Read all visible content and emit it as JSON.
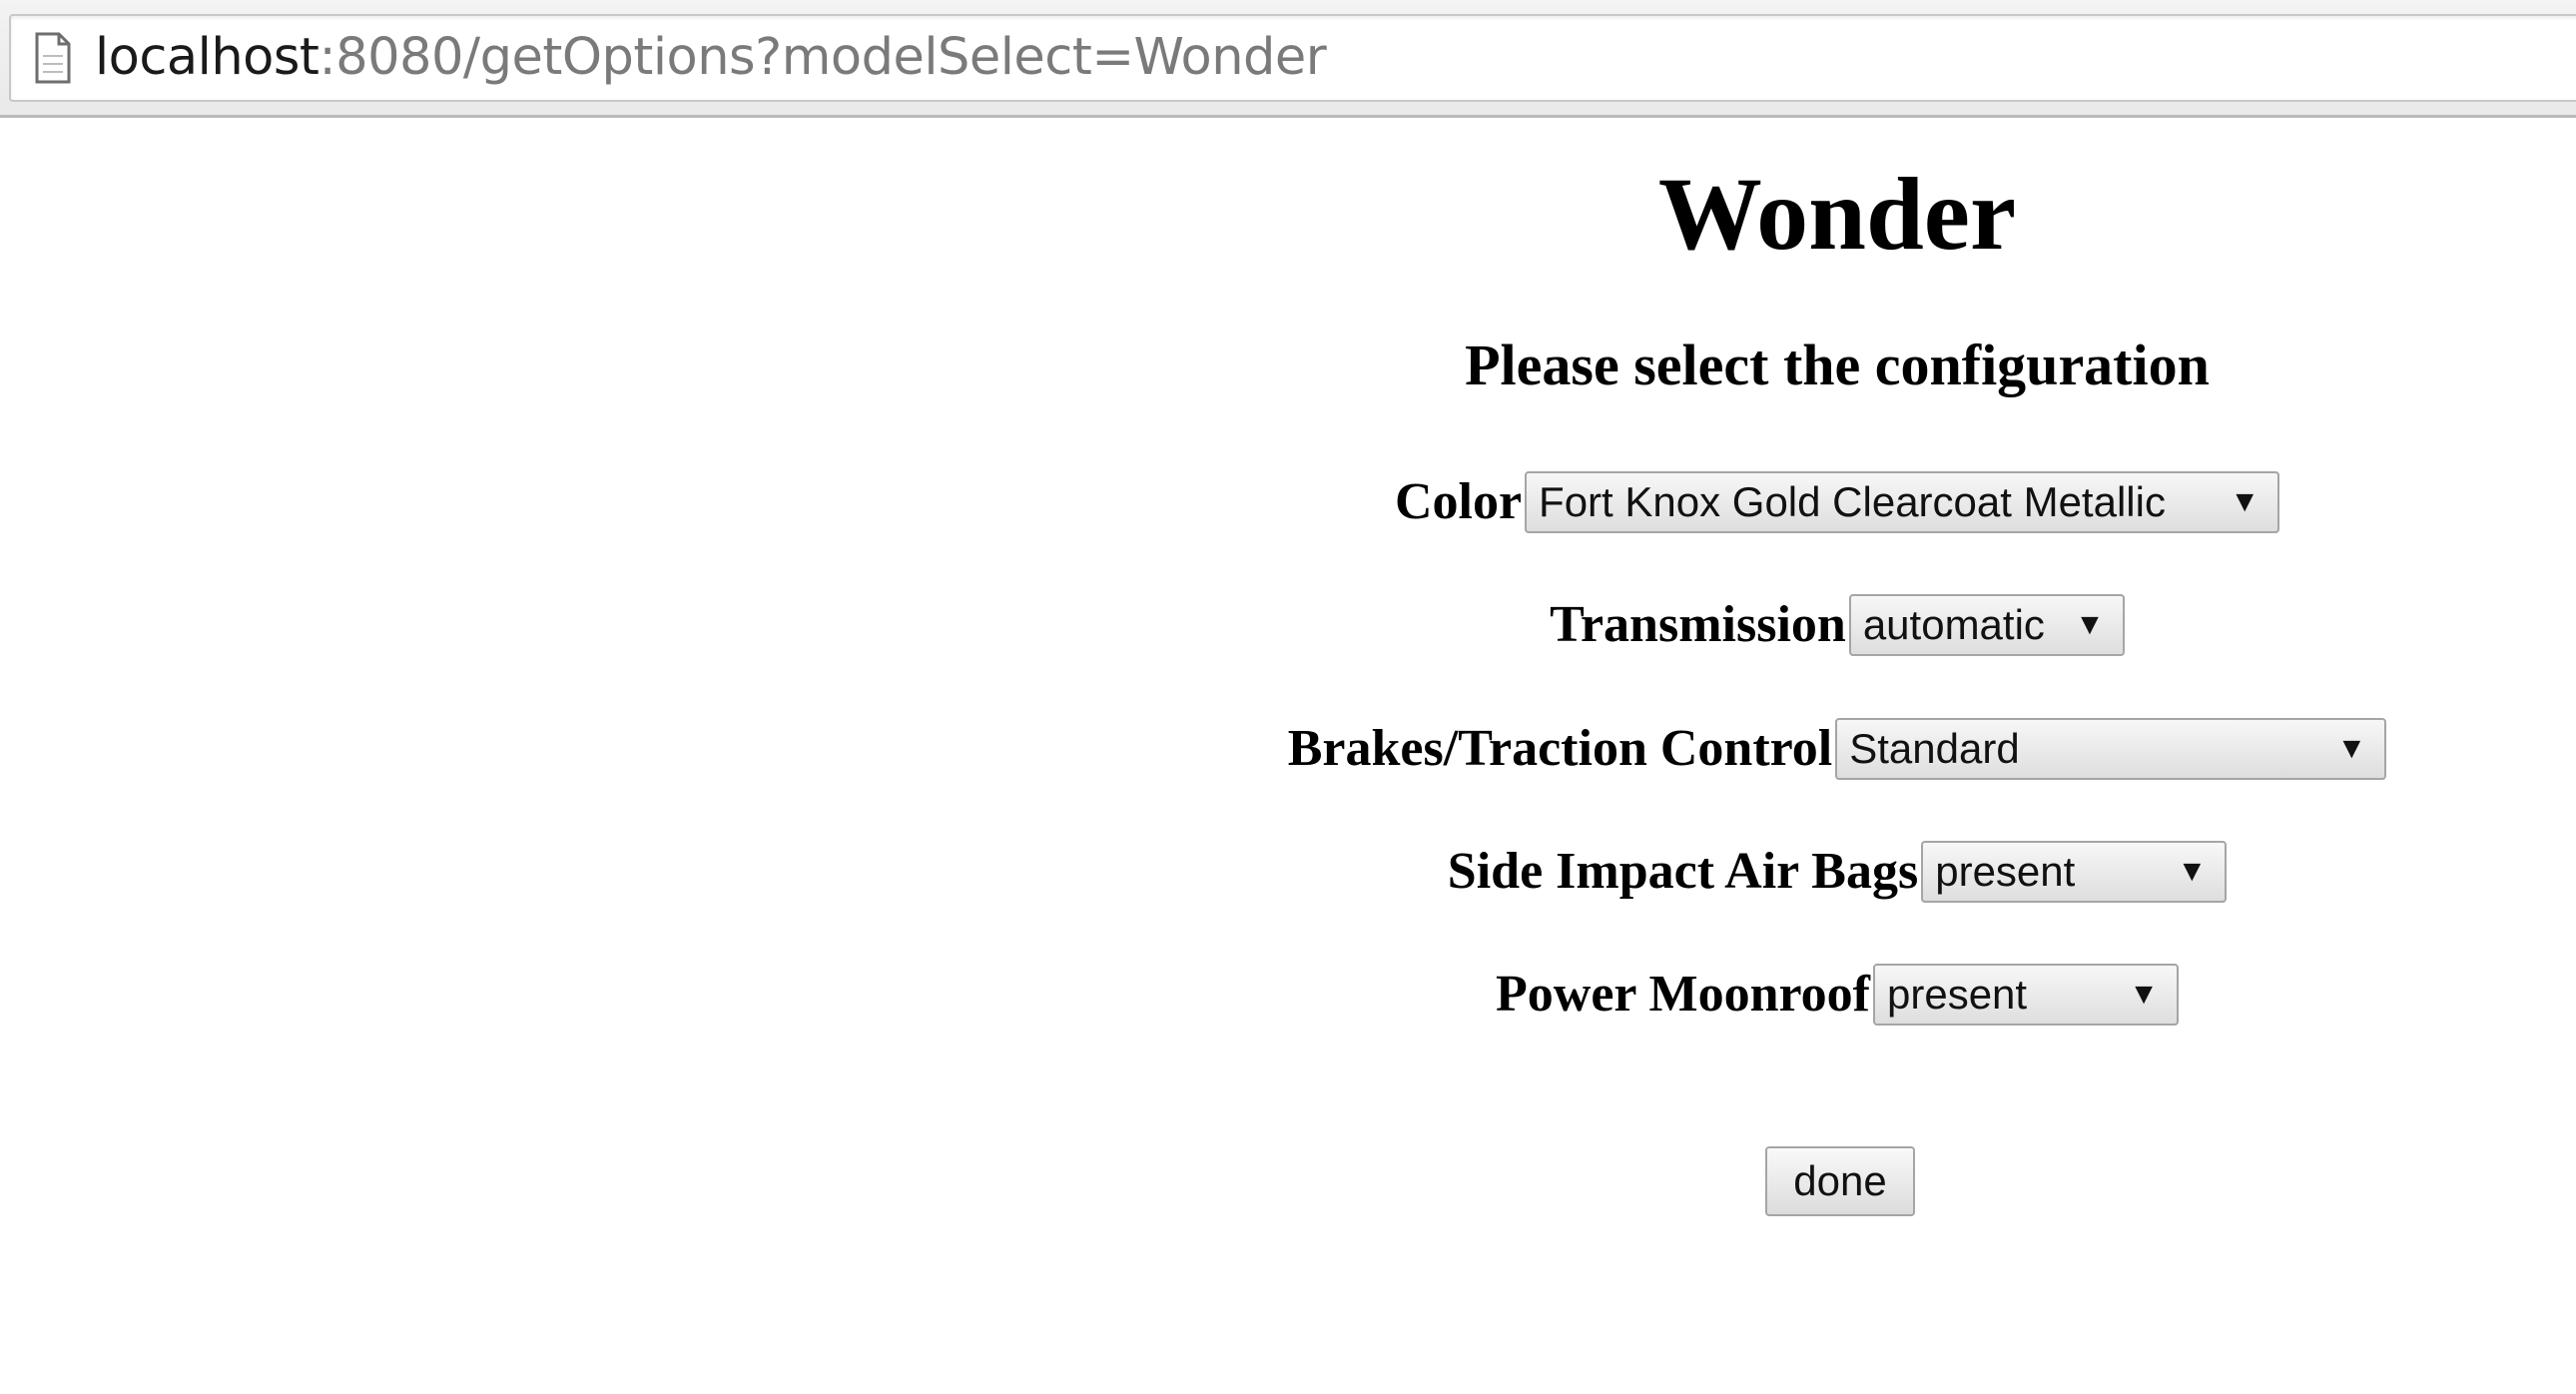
{
  "browser": {
    "url_host": "localhost",
    "url_rest": ":8080/getOptions?modelSelect=Wonder"
  },
  "page": {
    "title": "Wonder",
    "subtitle": "Please select the configuration"
  },
  "options": [
    {
      "label": "Color",
      "selected": "Fort Knox Gold Clearcoat Metallic"
    },
    {
      "label": "Transmission",
      "selected": "automatic"
    },
    {
      "label": "Brakes/Traction Control",
      "selected": "Standard"
    },
    {
      "label": "Side Impact Air Bags",
      "selected": "present"
    },
    {
      "label": "Power Moonroof",
      "selected": "present"
    }
  ],
  "done_label": "done",
  "icons": {
    "page": "page-icon",
    "dropdown": "chevron-down-icon",
    "dropdown_glyph": "▼"
  }
}
